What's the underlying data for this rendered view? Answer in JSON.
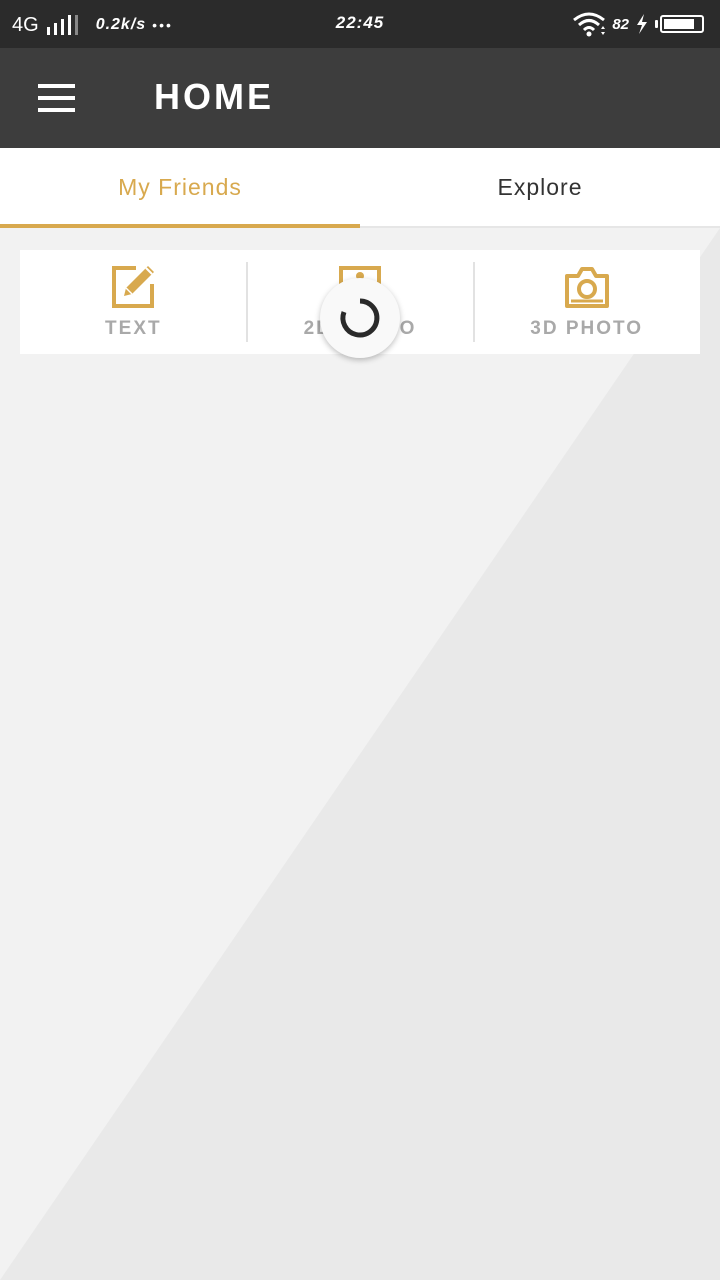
{
  "status_bar": {
    "network": "4G",
    "net_speed": "0.2k/s",
    "more_dots": "•••",
    "time": "22:45",
    "battery_pct": "82",
    "battery_level": 0.82,
    "wifi_icon": "wifi-icon",
    "battery_icon": "battery-icon"
  },
  "header": {
    "title": "HOME",
    "menu_icon": "hamburger-menu-icon"
  },
  "tabs": [
    {
      "label": "My Friends",
      "active": true
    },
    {
      "label": "Explore",
      "active": false
    }
  ],
  "compose": {
    "options": [
      {
        "label": "TEXT",
        "icon": "edit-icon"
      },
      {
        "label": "2D PHOTO",
        "icon": "picture-icon"
      },
      {
        "label": "3D PHOTO",
        "icon": "camera-icon"
      }
    ]
  },
  "loading": {
    "icon": "loading-spinner-icon"
  },
  "colors": {
    "accent": "#d8a94e",
    "app_bar": "#3d3d3d",
    "status_bar": "#2b2b2b",
    "label_gray": "#a9a9a9",
    "background": "#f2f2f2"
  }
}
